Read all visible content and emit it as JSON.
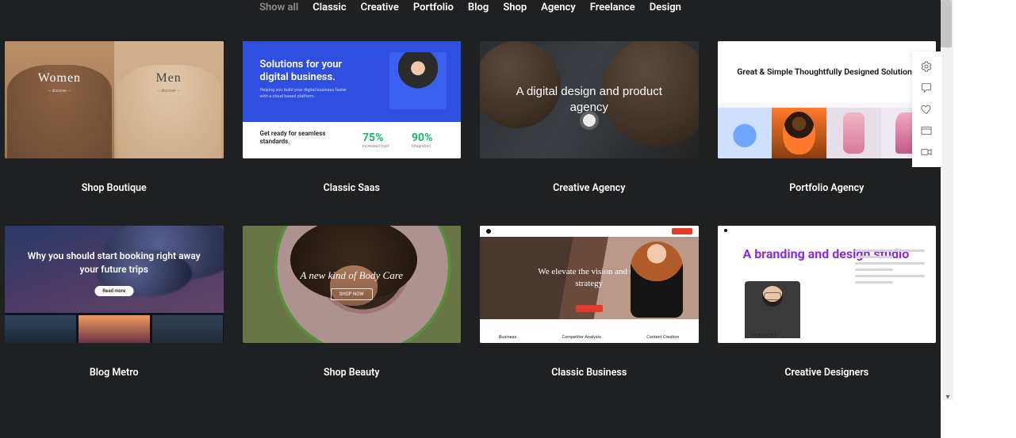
{
  "filters": {
    "items": [
      {
        "label": "Show all",
        "active": true
      },
      {
        "label": "Classic",
        "active": false
      },
      {
        "label": "Creative",
        "active": false
      },
      {
        "label": "Portfolio",
        "active": false
      },
      {
        "label": "Blog",
        "active": false
      },
      {
        "label": "Shop",
        "active": false
      },
      {
        "label": "Agency",
        "active": false
      },
      {
        "label": "Freelance",
        "active": false
      },
      {
        "label": "Design",
        "active": false
      }
    ]
  },
  "cards": [
    {
      "title": "Shop Boutique",
      "thumb": {
        "left_label": "Women",
        "right_label": "Men"
      }
    },
    {
      "title": "Classic Saas",
      "thumb": {
        "headline": "Solutions for your digital business.",
        "subhead": "Helping you build your digital business faster with a cloud based platform.",
        "caption": "Get ready for seamless standards.",
        "stat1_value": "75%",
        "stat1_label": "Increased trust",
        "stat2_value": "90%",
        "stat2_label": "Integration"
      }
    },
    {
      "title": "Creative Agency",
      "thumb": {
        "headline": "A digital design and product agency"
      }
    },
    {
      "title": "Portfolio Agency",
      "thumb": {
        "headline": "Great & Simple Thoughtfully Designed Solutions"
      }
    },
    {
      "title": "Blog Metro",
      "thumb": {
        "headline": "Why you should start booking right away your future trips",
        "button": "Read more"
      }
    },
    {
      "title": "Shop Beauty",
      "thumb": {
        "headline": "A new kind of Body Care",
        "button": "SHOP NOW"
      }
    },
    {
      "title": "Classic Business",
      "thumb": {
        "headline": "We elevate the vision and the strategy",
        "footer_left": "Business",
        "footer_mid": "Competitor Analysis",
        "footer_right": "Content Creation"
      }
    },
    {
      "title": "Creative Designers",
      "thumb": {
        "headline": "A branding and design studio",
        "caption": "← SERVICES"
      }
    }
  ],
  "rail": {
    "icons": [
      "gear-icon",
      "chat-icon",
      "heart-icon",
      "layout-icon",
      "video-icon"
    ]
  }
}
